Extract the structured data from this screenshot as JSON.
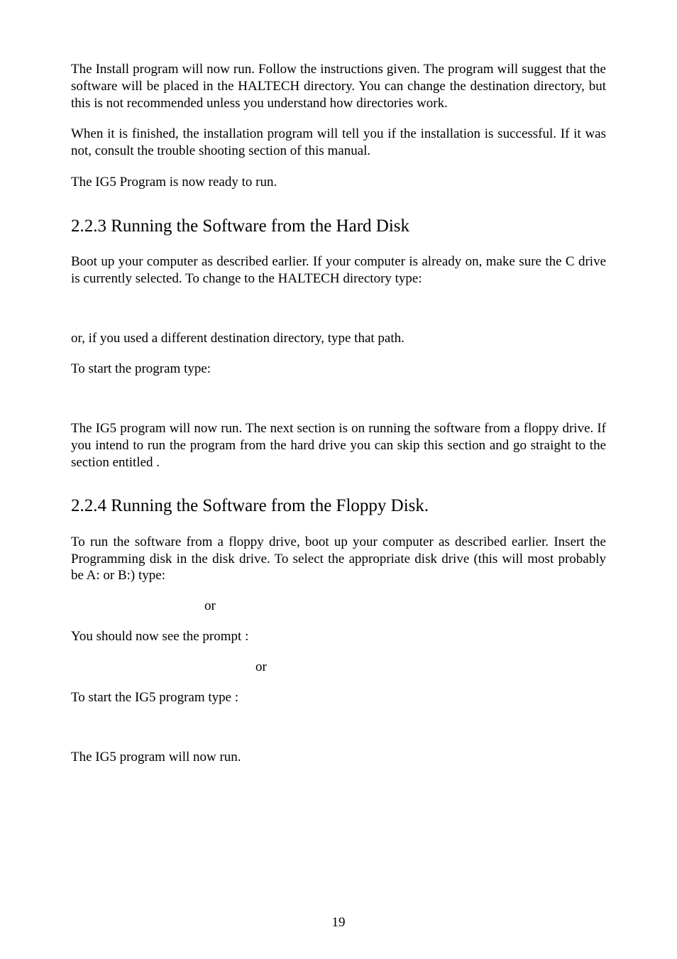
{
  "paragraphs": {
    "p1": "The Install program will now run.  Follow the instructions given.  The program will suggest that the software will be placed in the HALTECH directory.  You can change the destination directory, but this is not recommended unless you understand how directories work.",
    "p2": "When it is finished, the installation program will tell you if the installation is successful.  If it was not, consult the trouble shooting section of this manual.",
    "p3": "The IG5 Program is now ready to run.",
    "p4": "Boot up your computer as described earlier.  If your computer is already on, make sure the C drive is currently selected.  To change to the HALTECH directory type:",
    "p5": "or, if you used a different destination directory, type that path.",
    "p6": "To start the program type:",
    "p7": "The IG5 program will now run.  The next section is on running the software from a floppy drive.  If you intend to run the program from the hard drive you can skip this section and go straight to the section entitled                                       .",
    "p8": "To run the software from a floppy drive, boot up your computer as described earlier.  Insert the Programming disk in the disk drive.  To select the appropriate disk drive (this will most probably be A: or B:) type:",
    "p9": "You should now see the prompt :",
    "p10": "To start the IG5 program type :",
    "p11": "The IG5 program will now run."
  },
  "headings": {
    "h1": "2.2.3 Running the Software from the Hard Disk",
    "h2": "2.2.4 Running the Software from the Floppy Disk."
  },
  "misc": {
    "or": "or"
  },
  "page_number": "19"
}
